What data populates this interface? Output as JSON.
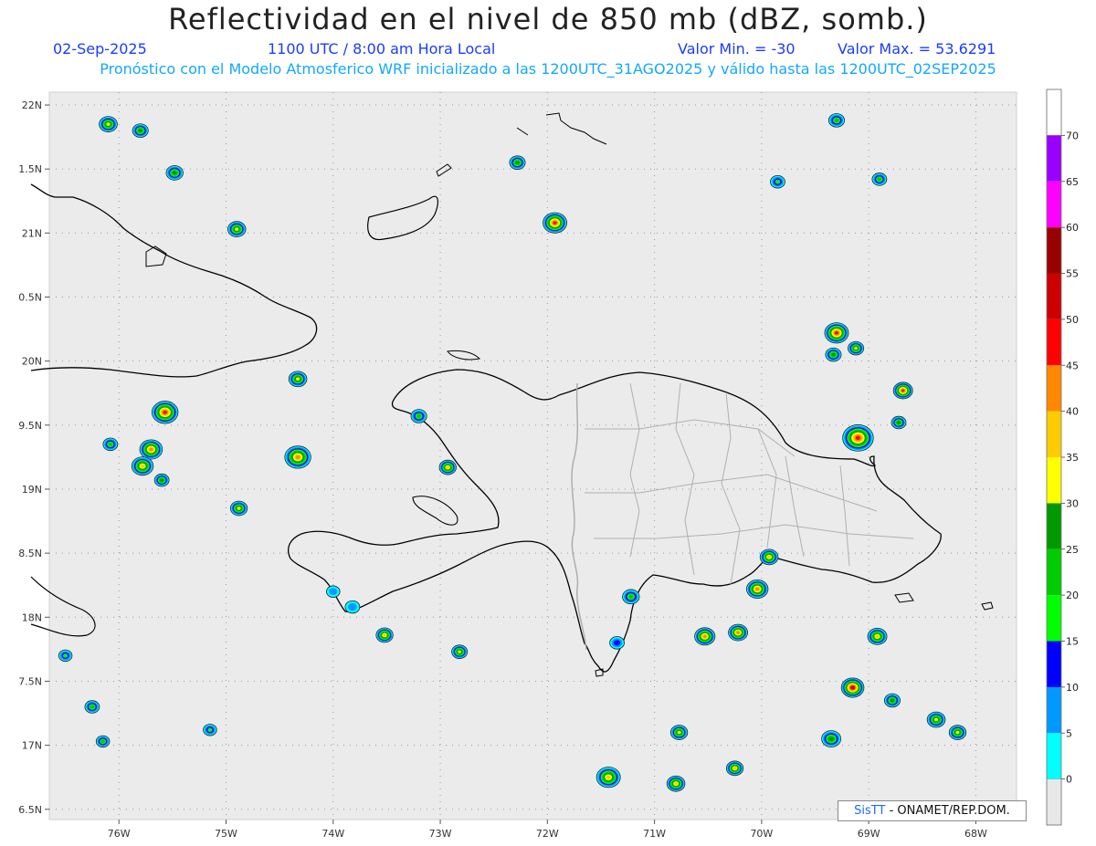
{
  "header": {
    "title": "Reflectividad en el nivel de 850 mb (dBZ, somb.)",
    "date": "02-Sep-2025",
    "time": "1100 UTC / 8:00 am Hora Local",
    "min_label": "Valor Min. = -30",
    "max_label": "Valor Max. = 53.6291",
    "forecast_line": "Pronóstico con el Modelo Atmosferico WRF inicializado a las 1200UTC_31AGO2025 y válido hasta las  1200UTC_02SEP2025"
  },
  "credit": {
    "brand": "SisTT",
    "text": "- ONAMET/REP.DOM."
  },
  "map": {
    "lon_range": [
      -76.65,
      -67.62
    ],
    "lat_range": [
      16.42,
      22.1
    ],
    "lat_ticks": [
      {
        "value": 22.0,
        "label": "22N"
      },
      {
        "value": 21.5,
        "label": "1.5N"
      },
      {
        "value": 21.0,
        "label": "21N"
      },
      {
        "value": 20.5,
        "label": "0.5N"
      },
      {
        "value": 20.0,
        "label": "20N"
      },
      {
        "value": 19.5,
        "label": "9.5N"
      },
      {
        "value": 19.0,
        "label": "19N"
      },
      {
        "value": 18.5,
        "label": "8.5N"
      },
      {
        "value": 18.0,
        "label": "18N"
      },
      {
        "value": 17.5,
        "label": "7.5N"
      },
      {
        "value": 17.0,
        "label": "17N"
      },
      {
        "value": 16.5,
        "label": "6.5N"
      }
    ],
    "lon_ticks": [
      {
        "value": -76,
        "label": "76W"
      },
      {
        "value": -75,
        "label": "75W"
      },
      {
        "value": -74,
        "label": "74W"
      },
      {
        "value": -73,
        "label": "73W"
      },
      {
        "value": -72,
        "label": "72W"
      },
      {
        "value": -71,
        "label": "71W"
      },
      {
        "value": -70,
        "label": "70W"
      },
      {
        "value": -69,
        "label": "69W"
      },
      {
        "value": -68,
        "label": "68W"
      }
    ],
    "grid": true
  },
  "colorbar": {
    "levels": [
      {
        "label": "0",
        "color": "#00ffff"
      },
      {
        "label": "5",
        "color": "#0099ff"
      },
      {
        "label": "10",
        "color": "#0000ff"
      },
      {
        "label": "15",
        "color": "#00ff00"
      },
      {
        "label": "20",
        "color": "#00cc00"
      },
      {
        "label": "25",
        "color": "#009900"
      },
      {
        "label": "30",
        "color": "#ffff00"
      },
      {
        "label": "35",
        "color": "#ffcc00"
      },
      {
        "label": "40",
        "color": "#ff8800"
      },
      {
        "label": "45",
        "color": "#ff0000"
      },
      {
        "label": "50",
        "color": "#cc0000"
      },
      {
        "label": "55",
        "color": "#990000"
      },
      {
        "label": "60",
        "color": "#ff00ff"
      },
      {
        "label": "65",
        "color": "#9900ff"
      },
      {
        "label": "70",
        "color": ""
      }
    ],
    "below_color": "#e8e8e8",
    "above_color": "#ffffff"
  },
  "cells": [
    {
      "lon": -75.57,
      "lat": 19.6,
      "dbz": 45,
      "size": 1.6
    },
    {
      "lon": -75.7,
      "lat": 19.31,
      "dbz": 42,
      "size": 1.3
    },
    {
      "lon": -75.78,
      "lat": 19.18,
      "dbz": 38,
      "size": 1.2
    },
    {
      "lon": -74.33,
      "lat": 19.25,
      "dbz": 44,
      "size": 1.6
    },
    {
      "lon": -74.33,
      "lat": 19.86,
      "dbz": 30,
      "size": 0.9
    },
    {
      "lon": -74.9,
      "lat": 21.03,
      "dbz": 32,
      "size": 0.9
    },
    {
      "lon": -76.1,
      "lat": 21.85,
      "dbz": 32,
      "size": 0.9
    },
    {
      "lon": -75.8,
      "lat": 21.8,
      "dbz": 25,
      "size": 0.7
    },
    {
      "lon": -75.48,
      "lat": 21.47,
      "dbz": 28,
      "size": 0.8
    },
    {
      "lon": -74.88,
      "lat": 18.85,
      "dbz": 32,
      "size": 0.8
    },
    {
      "lon": -71.93,
      "lat": 21.08,
      "dbz": 48,
      "size": 1.4
    },
    {
      "lon": -72.28,
      "lat": 21.55,
      "dbz": 25,
      "size": 0.7
    },
    {
      "lon": -69.3,
      "lat": 20.22,
      "dbz": 45,
      "size": 1.4
    },
    {
      "lon": -69.1,
      "lat": 19.4,
      "dbz": 47,
      "size": 2.0
    },
    {
      "lon": -68.68,
      "lat": 19.77,
      "dbz": 46,
      "size": 1.0
    },
    {
      "lon": -69.3,
      "lat": 21.88,
      "dbz": 20,
      "size": 0.7
    },
    {
      "lon": -70.04,
      "lat": 18.22,
      "dbz": 44,
      "size": 1.2
    },
    {
      "lon": -69.93,
      "lat": 18.47,
      "dbz": 38,
      "size": 0.9
    },
    {
      "lon": -69.15,
      "lat": 17.45,
      "dbz": 50,
      "size": 1.3
    },
    {
      "lon": -68.92,
      "lat": 17.85,
      "dbz": 35,
      "size": 1.0
    },
    {
      "lon": -70.53,
      "lat": 17.85,
      "dbz": 44,
      "size": 1.1
    },
    {
      "lon": -70.22,
      "lat": 17.88,
      "dbz": 40,
      "size": 1.0
    },
    {
      "lon": -71.43,
      "lat": 16.75,
      "dbz": 38,
      "size": 1.4
    },
    {
      "lon": -70.8,
      "lat": 16.7,
      "dbz": 35,
      "size": 0.9
    },
    {
      "lon": -70.77,
      "lat": 17.1,
      "dbz": 30,
      "size": 0.8
    },
    {
      "lon": -70.25,
      "lat": 16.82,
      "dbz": 36,
      "size": 0.8
    },
    {
      "lon": -69.35,
      "lat": 17.05,
      "dbz": 25,
      "size": 1.0
    },
    {
      "lon": -68.37,
      "lat": 17.2,
      "dbz": 32,
      "size": 0.9
    },
    {
      "lon": -68.17,
      "lat": 17.1,
      "dbz": 30,
      "size": 0.8
    },
    {
      "lon": -68.78,
      "lat": 17.35,
      "dbz": 25,
      "size": 0.7
    },
    {
      "lon": -73.52,
      "lat": 17.86,
      "dbz": 36,
      "size": 0.8
    },
    {
      "lon": -72.82,
      "lat": 17.73,
      "dbz": 30,
      "size": 0.7
    },
    {
      "lon": -72.93,
      "lat": 19.17,
      "dbz": 35,
      "size": 0.8
    },
    {
      "lon": -73.2,
      "lat": 19.57,
      "dbz": 22,
      "size": 0.7
    },
    {
      "lon": -71.22,
      "lat": 18.16,
      "dbz": 22,
      "size": 0.8
    },
    {
      "lon": -71.35,
      "lat": 17.8,
      "dbz": 10,
      "size": 0.6
    },
    {
      "lon": -73.82,
      "lat": 18.08,
      "dbz": 8,
      "size": 0.6
    },
    {
      "lon": -74.0,
      "lat": 18.2,
      "dbz": 5,
      "size": 0.5
    },
    {
      "lon": -69.85,
      "lat": 21.4,
      "dbz": 18,
      "size": 0.6
    },
    {
      "lon": -68.9,
      "lat": 21.42,
      "dbz": 20,
      "size": 0.6
    },
    {
      "lon": -75.6,
      "lat": 19.07,
      "dbz": 25,
      "size": 0.6
    },
    {
      "lon": -76.08,
      "lat": 19.35,
      "dbz": 20,
      "size": 0.6
    },
    {
      "lon": -76.25,
      "lat": 17.3,
      "dbz": 20,
      "size": 0.6
    },
    {
      "lon": -76.5,
      "lat": 17.7,
      "dbz": 18,
      "size": 0.5
    },
    {
      "lon": -69.33,
      "lat": 20.05,
      "dbz": 28,
      "size": 0.7
    },
    {
      "lon": -69.12,
      "lat": 20.1,
      "dbz": 30,
      "size": 0.7
    },
    {
      "lon": -68.72,
      "lat": 19.52,
      "dbz": 28,
      "size": 0.6
    },
    {
      "lon": -75.15,
      "lat": 17.12,
      "dbz": 18,
      "size": 0.5
    },
    {
      "lon": -76.15,
      "lat": 17.03,
      "dbz": 20,
      "size": 0.5
    }
  ]
}
